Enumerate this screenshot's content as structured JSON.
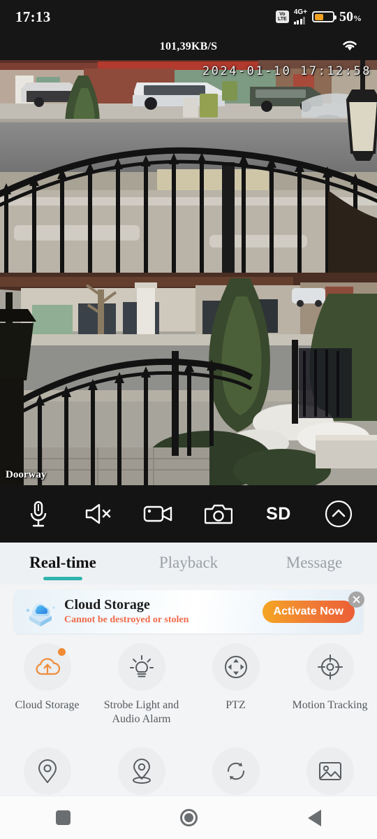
{
  "status_bar": {
    "clock": "17:13",
    "volte_label_top": "Vo",
    "volte_label_bottom": "LTE",
    "network_label": "4G+",
    "battery_percent": "50",
    "percent_symbol": "%"
  },
  "speed_bar": {
    "speed": "101,39KB/S"
  },
  "feeds": [
    {
      "name": "camera-1",
      "timestamp": "2024-01-10 17:12:58",
      "label": ""
    },
    {
      "name": "camera-2",
      "timestamp": "",
      "label": "Doorway"
    }
  ],
  "controls": [
    {
      "name": "microphone",
      "label": ""
    },
    {
      "name": "speaker-muted",
      "label": ""
    },
    {
      "name": "record-video",
      "label": ""
    },
    {
      "name": "snapshot-camera",
      "label": ""
    },
    {
      "name": "quality-sd",
      "label": "SD"
    },
    {
      "name": "expand-up",
      "label": ""
    }
  ],
  "tabs": [
    {
      "label": "Real-time",
      "active": true
    },
    {
      "label": "Playback",
      "active": false
    },
    {
      "label": "Message",
      "active": false
    }
  ],
  "banner": {
    "title": "Cloud Storage",
    "subtitle": "Cannot be destroyed or stolen",
    "cta": "Activate Now"
  },
  "features_row1": [
    {
      "label": "Cloud Storage",
      "icon": "cloud-upload-icon",
      "badge": true
    },
    {
      "label": "Strobe Light and\nAudio Alarm",
      "icon": "lightbulb-icon",
      "badge": false
    },
    {
      "label": "PTZ",
      "icon": "ptz-pad-icon",
      "badge": false
    },
    {
      "label": "Motion Tracking",
      "icon": "crosshair-target-icon",
      "badge": false
    }
  ],
  "features_row2": [
    {
      "label": "",
      "icon": "location-pin-icon",
      "badge": false
    },
    {
      "label": "",
      "icon": "location-pin-base-icon",
      "badge": false
    },
    {
      "label": "",
      "icon": "refresh-sync-icon",
      "badge": false
    },
    {
      "label": "",
      "icon": "image-gallery-icon",
      "badge": false
    }
  ],
  "navbar": [
    {
      "name": "recents",
      "label": ""
    },
    {
      "name": "home",
      "label": ""
    },
    {
      "name": "back",
      "label": ""
    }
  ],
  "colors": {
    "accent_teal": "#2fb3ad",
    "accent_orange": "#f08b34",
    "status_bg": "#161616",
    "page_bg": "#f2f4f6"
  }
}
